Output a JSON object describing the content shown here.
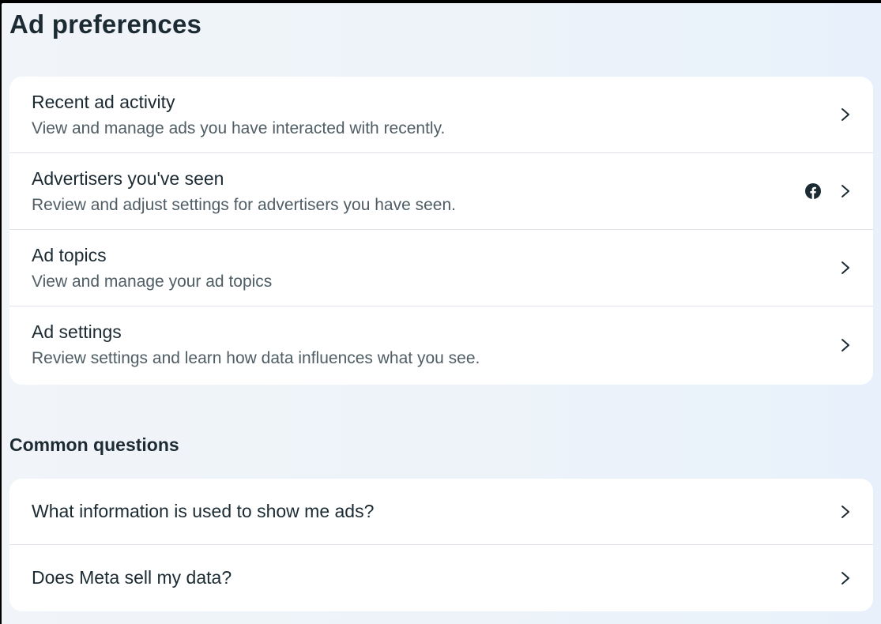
{
  "page_title": "Ad preferences",
  "preferences": [
    {
      "title": "Recent ad activity",
      "subtitle": "View and manage ads you have interacted with recently."
    },
    {
      "title": "Advertisers you've seen",
      "subtitle": "Review and adjust settings for advertisers you have seen.",
      "badge_icon": "facebook-icon"
    },
    {
      "title": "Ad topics",
      "subtitle": "View and manage your ad topics"
    },
    {
      "title": "Ad settings",
      "subtitle": "Review settings and learn how data influences what you see."
    }
  ],
  "common_questions": {
    "heading": "Common questions",
    "items": [
      {
        "title": "What information is used to show me ads?"
      },
      {
        "title": "Does Meta sell my data?"
      }
    ]
  },
  "icons": {
    "row_arrow": "chevron-right-icon"
  },
  "colors": {
    "text_primary": "#1c2b33",
    "text_secondary": "#4f5d65",
    "card_background": "#ffffff",
    "divider": "#dde3e8"
  }
}
